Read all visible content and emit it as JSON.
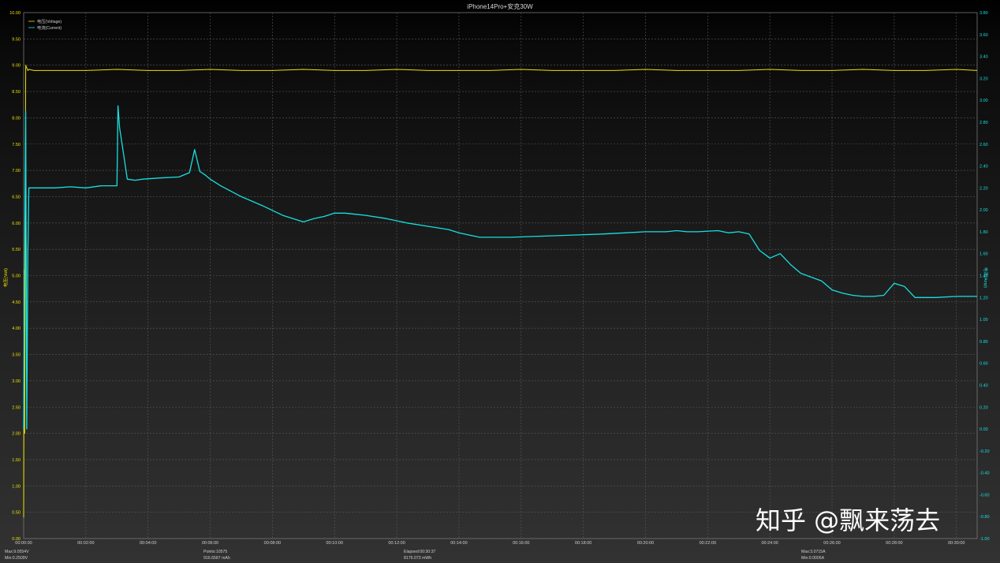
{
  "watermark": "知乎 @飘来荡去",
  "stats": {
    "max_voltage": "Max:9.0554V",
    "min_voltage": "Min:0.2509V",
    "points": "Points:10575",
    "energy_mah": "916.6587 mAh",
    "elapsed": "Elapsed:00:30:37",
    "energy_mwh": "8176.073 mWh",
    "max_current": "Max:3.0715A",
    "min_current": "Min:0.0005A"
  },
  "chart_data": {
    "type": "line",
    "title": "iPhone14Pro+安克30W",
    "ylabel": "电压(Volt)",
    "y2label": "电流(Amp)",
    "ylim": [
      0,
      10
    ],
    "y2lim": [
      -1.0,
      3.8
    ],
    "xlim_seconds": [
      0,
      1840
    ],
    "x_tick_labels": [
      "00:00:00",
      "00:02:00",
      "00:04:00",
      "00:06:00",
      "00:08:00",
      "00:10:00",
      "00:12:00",
      "00:14:00",
      "00:16:00",
      "00:18:00",
      "00:20:00",
      "00:22:00",
      "00:24:00",
      "00:26:00",
      "00:28:00",
      "00:30:00"
    ],
    "y_tick_labels": [
      "0.00",
      "0.50",
      "1.00",
      "1.50",
      "2.00",
      "2.50",
      "3.00",
      "3.50",
      "4.00",
      "4.50",
      "5.00",
      "5.50",
      "6.00",
      "6.50",
      "7.00",
      "7.50",
      "8.00",
      "8.50",
      "9.00",
      "9.50",
      "10.00"
    ],
    "y2_tick_labels": [
      "-1.00",
      "-0.80",
      "-0.60",
      "-0.40",
      "-0.20",
      "0.00",
      "0.20",
      "0.40",
      "0.60",
      "0.80",
      "1.00",
      "1.20",
      "1.40",
      "1.60",
      "1.80",
      "2.00",
      "2.20",
      "2.40",
      "2.60",
      "2.80",
      "3.00",
      "3.20",
      "3.40",
      "3.60",
      "3.80"
    ],
    "grid": true,
    "legend_position": "top-left",
    "series": [
      {
        "name": "电压(Voltage)",
        "color": "#f0e000",
        "axis": "left",
        "x": [
          0,
          1,
          2,
          3,
          4,
          6,
          8,
          10,
          20,
          60,
          120,
          180,
          240,
          300,
          360,
          420,
          480,
          540,
          600,
          660,
          720,
          780,
          840,
          900,
          960,
          1020,
          1080,
          1140,
          1200,
          1260,
          1320,
          1380,
          1440,
          1500,
          1560,
          1620,
          1680,
          1740,
          1800,
          1840
        ],
        "values": [
          0.4,
          5.1,
          2.0,
          5.1,
          9.0,
          8.95,
          8.9,
          8.92,
          8.9,
          8.9,
          8.9,
          8.92,
          8.9,
          8.9,
          8.92,
          8.9,
          8.9,
          8.92,
          8.9,
          8.9,
          8.92,
          8.9,
          8.9,
          8.9,
          8.92,
          8.9,
          8.9,
          8.9,
          8.92,
          8.9,
          8.9,
          8.9,
          8.92,
          8.9,
          8.9,
          8.92,
          8.9,
          8.9,
          8.92,
          8.9
        ]
      },
      {
        "name": "电流(Current)",
        "color": "#18e0e0",
        "axis": "right",
        "x": [
          0,
          2,
          4,
          6,
          8,
          10,
          20,
          30,
          60,
          90,
          120,
          150,
          180,
          182,
          185,
          190,
          200,
          215,
          230,
          260,
          300,
          320,
          330,
          340,
          350,
          360,
          380,
          420,
          460,
          500,
          540,
          560,
          580,
          600,
          620,
          640,
          660,
          700,
          740,
          780,
          820,
          840,
          860,
          880,
          900,
          940,
          1000,
          1060,
          1120,
          1160,
          1200,
          1240,
          1260,
          1280,
          1300,
          1340,
          1360,
          1380,
          1400,
          1420,
          1440,
          1460,
          1480,
          1500,
          1540,
          1560,
          1580,
          1600,
          1620,
          1640,
          1660,
          1680,
          1700,
          1720,
          1740,
          1760,
          1800,
          1840
        ],
        "values": [
          0.0,
          1.6,
          2.9,
          0.0,
          1.6,
          2.2,
          2.2,
          2.2,
          2.2,
          2.21,
          2.2,
          2.22,
          2.22,
          2.95,
          2.75,
          2.6,
          2.28,
          2.27,
          2.28,
          2.29,
          2.3,
          2.34,
          2.55,
          2.35,
          2.32,
          2.28,
          2.22,
          2.12,
          2.04,
          1.95,
          1.89,
          1.92,
          1.94,
          1.97,
          1.97,
          1.96,
          1.95,
          1.92,
          1.88,
          1.85,
          1.82,
          1.79,
          1.77,
          1.75,
          1.75,
          1.75,
          1.76,
          1.77,
          1.78,
          1.79,
          1.8,
          1.8,
          1.81,
          1.8,
          1.8,
          1.81,
          1.79,
          1.8,
          1.78,
          1.63,
          1.56,
          1.6,
          1.5,
          1.42,
          1.35,
          1.27,
          1.24,
          1.22,
          1.21,
          1.21,
          1.22,
          1.33,
          1.3,
          1.2,
          1.2,
          1.2,
          1.21,
          1.21
        ]
      }
    ]
  }
}
